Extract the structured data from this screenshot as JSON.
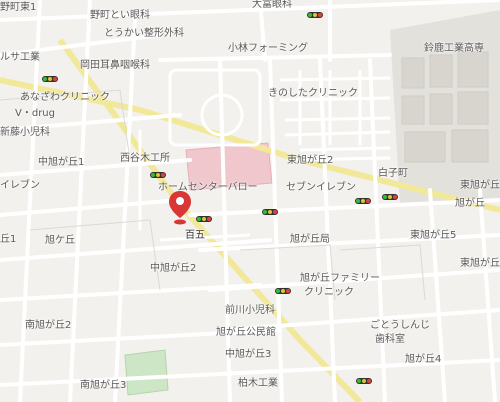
{
  "labels": {
    "hospital_top": "大富眼科",
    "noma_clinic": "野町とい眼科",
    "tokai_seikei": "とうかい整形外科",
    "kobayashi_forming": "小林フォーミング",
    "suzuka_kogyo": "鈴鹿工業高専",
    "okada_jibika": "岡田耳鼻咽喉科",
    "anazawa": "あなざわクリニック",
    "v_drug": "V・drug",
    "kinoshita": "きのしたクリニック",
    "shinfuji": "新藤小児科",
    "fujimachi_1": "野町東1",
    "ruhsa": "ルサ工業",
    "nishiyagi": "西谷木工所",
    "homecenter": "ホームセンターバロー",
    "seveneleven_right": "セブンイレブン",
    "higashi_asahi2": "東旭が丘2",
    "naka_asahi1": "中旭が丘1",
    "seveneleven_left": "イレブン",
    "asahi_5_top": "東旭が丘",
    "asahigaoka_right": "旭が丘",
    "momogo": "百五",
    "asahi_post": "旭が丘局",
    "higashi_asahi5": "東旭が丘5",
    "asahi1_left": "丘1",
    "asahigaoka_circle": "旭ケ丘",
    "naka_asahi2": "中旭が丘2",
    "asahi_family": "旭が丘ファミリー",
    "family_clinic": "クリニック",
    "maegawa": "前川小児科",
    "minami_asahi2": "南旭が丘2",
    "asahi_kominkan": "旭が丘公民館",
    "gotou": "ごとうしんじ",
    "shika": "歯科室",
    "naka_asahi3": "中旭が丘3",
    "minami_asahi3": "南旭が丘3",
    "asahi_4": "旭が丘4",
    "kashiwagi": "柏木工業",
    "shiraco": "白子町",
    "higashi_asahi_3": "東旭が丘3"
  },
  "marker": {
    "label": "百五",
    "color": "#d93636"
  },
  "colors": {
    "building_pink": "#f0c9cf",
    "park": "#cfe8c7",
    "road_minor": "#ffffff",
    "road_major": "#f4ea9c",
    "land": "#f4f2ee",
    "block": "#e6e3de"
  }
}
